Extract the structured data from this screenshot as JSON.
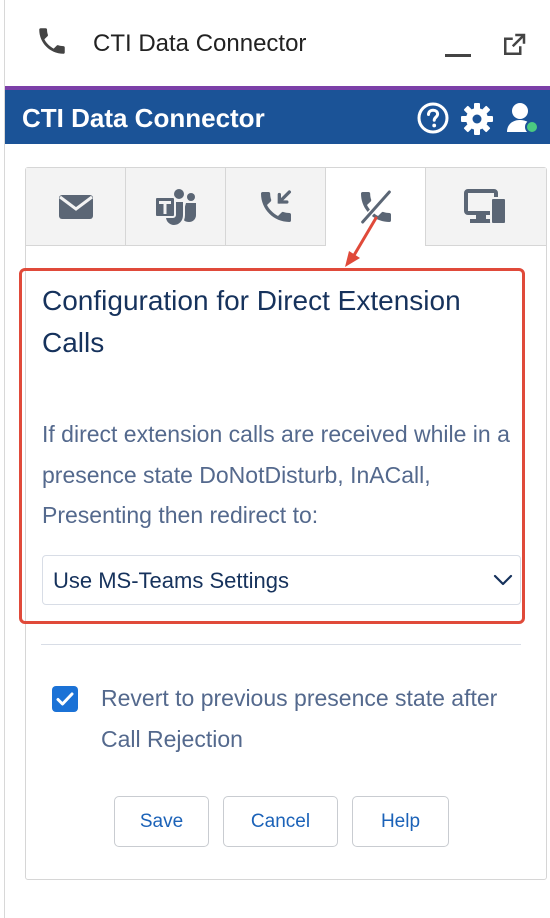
{
  "window": {
    "title": "CTI Data Connector"
  },
  "app": {
    "title": "CTI Data Connector"
  },
  "tabs": [
    {
      "icon": "envelope-icon"
    },
    {
      "icon": "ms-teams-icon"
    },
    {
      "icon": "incoming-call-icon"
    },
    {
      "icon": "call-reject-icon",
      "active": true
    },
    {
      "icon": "screen-share-icon"
    }
  ],
  "config": {
    "title": "Configuration for Direct Extension Calls",
    "description": "If direct extension calls are received while in a presence state DoNotDisturb, InACall, Presenting then redirect to:",
    "redirect_select": {
      "value": "Use MS-Teams Settings"
    },
    "revert_checkbox": {
      "label": "Revert to previous presence state after Call Rejection",
      "checked": true
    }
  },
  "buttons": {
    "save": "Save",
    "cancel": "Cancel",
    "help": "Help"
  },
  "colors": {
    "header_bg": "#1b5397",
    "accent_line": "#7b3fa8",
    "highlight": "#e04a3a",
    "checkbox": "#1b72d6",
    "button_text": "#1b62b8"
  }
}
